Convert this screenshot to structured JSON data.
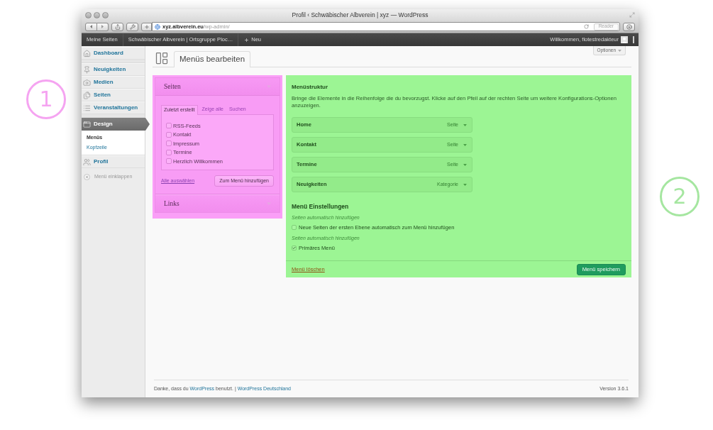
{
  "window": {
    "title": "Profil ‹ Schwäbischer Albverein | xyz — WordPress"
  },
  "toolbar": {
    "url": {
      "host": "xyz.albverein.eu",
      "path": "/wp-admin/"
    },
    "reader_button": "Reader"
  },
  "admin_bar": {
    "items": [
      "Meine Seiten",
      "Schwäbischer Albverein | Ortsgruppe Ploc…"
    ],
    "new_label": "Neu",
    "greeting": "Willkommen, flotestredakteur"
  },
  "sidebar": {
    "groups": [
      [
        {
          "label": "Dashboard",
          "selected": false
        }
      ],
      [
        {
          "label": "Neuigkeiten",
          "selected": false
        },
        {
          "label": "Medien",
          "selected": false
        },
        {
          "label": "Seiten",
          "selected": false
        },
        {
          "label": "Veranstaltungen",
          "selected": false
        }
      ],
      [
        {
          "label": "Design",
          "selected": true,
          "children": [
            {
              "label": "Menüs",
              "selected": true
            },
            {
              "label": "Kopfzeile",
              "selected": false
            }
          ]
        },
        {
          "label": "Profil",
          "selected": false
        }
      ]
    ],
    "collapse": "Menü einklappen"
  },
  "page": {
    "title": "Menüs bearbeiten",
    "screen_options": "Optionen"
  },
  "menu_sources": {
    "sections": [
      {
        "title": "Seiten",
        "expanded": true,
        "tabs": [
          {
            "label": "Zuletzt erstellt",
            "selected": true
          },
          {
            "label": "Zeige alle",
            "selected": false
          },
          {
            "label": "Suchen",
            "selected": false
          }
        ],
        "items": [
          {
            "label": "RSS-Feeds",
            "checked": false
          },
          {
            "label": "Kontakt",
            "checked": false
          },
          {
            "label": "Impressum",
            "checked": false
          },
          {
            "label": "Termine",
            "checked": false
          },
          {
            "label": "Herzlich Willkommen",
            "checked": false
          }
        ],
        "select_all": "Alle auswählen",
        "add_button": "Zum Menü hinzufügen"
      },
      {
        "title": "Links",
        "expanded": false
      }
    ]
  },
  "menu_editor": {
    "title": "Menüstruktur",
    "description": "Bringe die Elemente in die Reihenfolge die du bevorzugst. Klicke auf den Pfeil auf der rechten Seite um weitere Konfigurations-Optionen anzuzeigen.",
    "items": [
      {
        "title": "Home",
        "type": "Seite"
      },
      {
        "title": "Kontakt",
        "type": "Seite"
      },
      {
        "title": "Termine",
        "type": "Seite"
      },
      {
        "title": "Neuigkeiten",
        "type": "Kategorie"
      }
    ],
    "settings": {
      "title": "Menü Einstellungen",
      "options": [
        {
          "caption": "Seiten automatisch hinzufügen",
          "label": "Neue Seiten der ersten Ebene automatisch zum Menü hinzufügen",
          "checked": false
        },
        {
          "caption": "Seiten automatisch hinzufügen",
          "label": "Primäres Menü",
          "checked": true
        }
      ]
    },
    "delete_link": "Menü löschen",
    "save_button": "Menü speichern"
  },
  "footer": {
    "thanks": [
      {
        "kind": "text",
        "text": "Danke, dass du "
      },
      {
        "kind": "link",
        "text": "WordPress"
      },
      {
        "kind": "text",
        "text": " benutzt. | "
      },
      {
        "kind": "link",
        "text": "WordPress Deutschland"
      }
    ],
    "version": "Version 3.6.1"
  },
  "annotations": [
    {
      "number": "1",
      "color": "#f5a4f1"
    },
    {
      "number": "2",
      "color": "#a5e6a0"
    }
  ]
}
